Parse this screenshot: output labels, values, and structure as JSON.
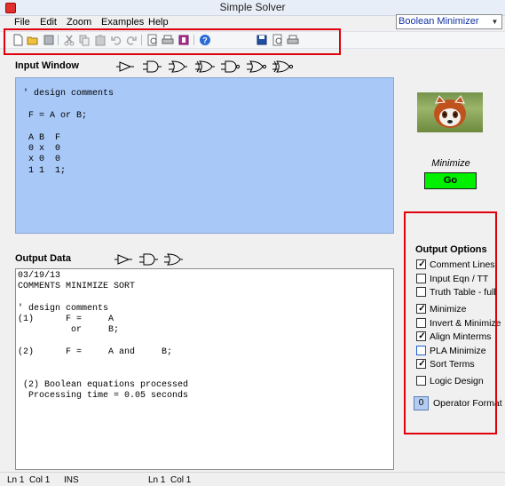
{
  "window": {
    "title": "Simple Solver"
  },
  "menu": [
    "File",
    "Edit",
    "Zoom",
    "Examples",
    "Help"
  ],
  "mode_select": {
    "value": "Boolean Minimizer"
  },
  "toolbar_icons": [
    "new-file-icon",
    "open-folder-icon",
    "save-icon",
    "cut-icon",
    "copy-icon",
    "paste-icon",
    "undo-icon",
    "redo-icon",
    "print-preview-icon",
    "print-icon",
    "export-icon",
    "help-icon",
    "save-output-icon",
    "output-preview-icon",
    "output-print-icon"
  ],
  "input_window": {
    "label": "Input Window",
    "gate_icons": [
      "buffer-gate-icon",
      "and-gate-icon",
      "or-gate-icon",
      "xor-gate-icon",
      "nand-gate-icon",
      "nor-gate-icon",
      "xnor-gate-icon"
    ],
    "text": "' design comments\n\n F = A or B;\n\n A B  F\n 0 x  0\n x 0  0\n 1 1  1;"
  },
  "output_data": {
    "label": "Output Data",
    "gate_icons": [
      "buffer-gate-icon",
      "and-gate-icon",
      "or-gate-icon"
    ],
    "text": "03/19/13\nCOMMENTS MINIMIZE SORT\n\n' design comments\n(1)      F =     A\n          or     B;\n\n(2)      F =     A and     B;\n\n\n (2) Boolean equations processed\n  Processing time = 0.05 seconds"
  },
  "minimize": {
    "label": "Minimize",
    "go_label": "Go"
  },
  "output_options": {
    "title": "Output Options",
    "items": [
      {
        "label": "Comment Lines",
        "checked": true
      },
      {
        "label": "Input Eqn / TT",
        "checked": false
      },
      {
        "label": "Truth Table - full",
        "checked": false
      },
      {
        "label": "Minimize",
        "checked": true
      },
      {
        "label": "Invert & Minimize",
        "checked": false
      },
      {
        "label": "Align Minterms",
        "checked": true
      },
      {
        "label": "PLA Minimize",
        "checked": false
      },
      {
        "label": "Sort Terms",
        "checked": true
      },
      {
        "label": "Logic Design",
        "checked": false
      }
    ],
    "operator_format": {
      "value": "0",
      "label": "Operator Format"
    }
  },
  "status": {
    "ln1": "Ln 1",
    "col1": "Col 1",
    "ins": "INS",
    "ln2": "Ln 1",
    "col2": "Col 1"
  },
  "colors": {
    "input_bg": "#a8c8f7",
    "go_button": "#00f000",
    "annotation": "#e0000b"
  }
}
